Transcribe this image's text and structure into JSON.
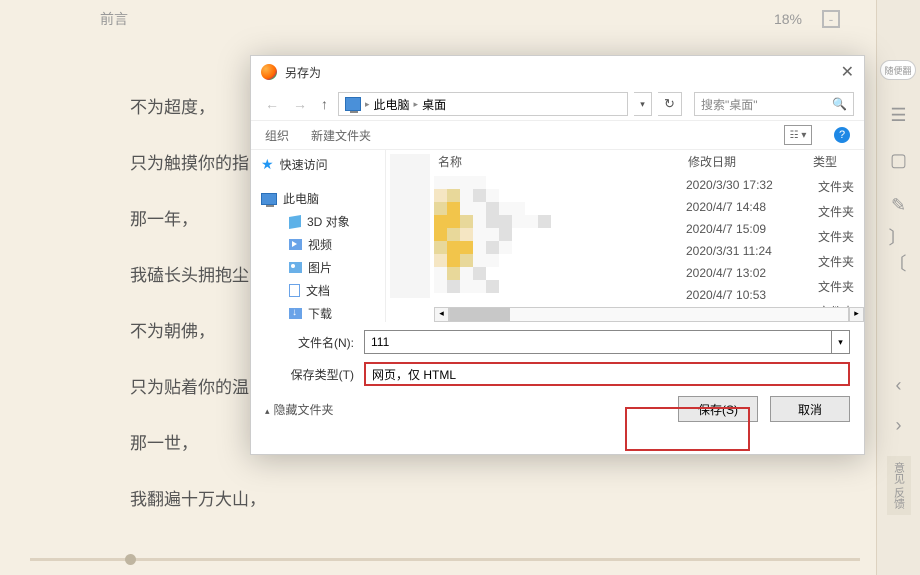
{
  "topbar": {
    "title": "前言",
    "percent": "18%"
  },
  "sidebar": {
    "pill": "随便翻",
    "feedback": "意见\n反馈"
  },
  "poem": {
    "lines": [
      "不为超度，",
      "只为触摸你的指",
      "那一年，",
      "我磕长头拥抱尘",
      "不为朝佛，",
      "只为贴着你的温",
      "那一世，",
      "我翻遍十万大山，"
    ]
  },
  "dialog": {
    "title": "另存为",
    "path": {
      "computer": "此电脑",
      "desktop": "桌面"
    },
    "search_placeholder": "搜索\"桌面\"",
    "toolbar": {
      "organize": "组织",
      "new_folder": "新建文件夹"
    },
    "tree": {
      "quick_access": "快速访问",
      "this_pc": "此电脑",
      "children": [
        "3D 对象",
        "视频",
        "图片",
        "文档",
        "下载"
      ]
    },
    "columns": {
      "name": "名称",
      "date_modified": "修改日期",
      "type": "类型"
    },
    "rows": [
      {
        "date": "2020/3/30 17:32",
        "type": "文件夹"
      },
      {
        "date": "2020/4/7 14:48",
        "type": "文件夹"
      },
      {
        "date": "2020/4/7 15:09",
        "type": "文件夹"
      },
      {
        "date": "2020/3/31 11:24",
        "type": "文件夹"
      },
      {
        "date": "2020/4/7 13:02",
        "type": "文件夹"
      },
      {
        "date": "2020/4/7 10:53",
        "type": "文件夹"
      }
    ],
    "filename_label": "文件名(N):",
    "filename_value": "111",
    "type_label": "保存类型(T)",
    "type_value": "网页，仅 HTML",
    "hide_folders": "隐藏文件夹",
    "save_btn": "保存(S)",
    "cancel_btn": "取消"
  }
}
